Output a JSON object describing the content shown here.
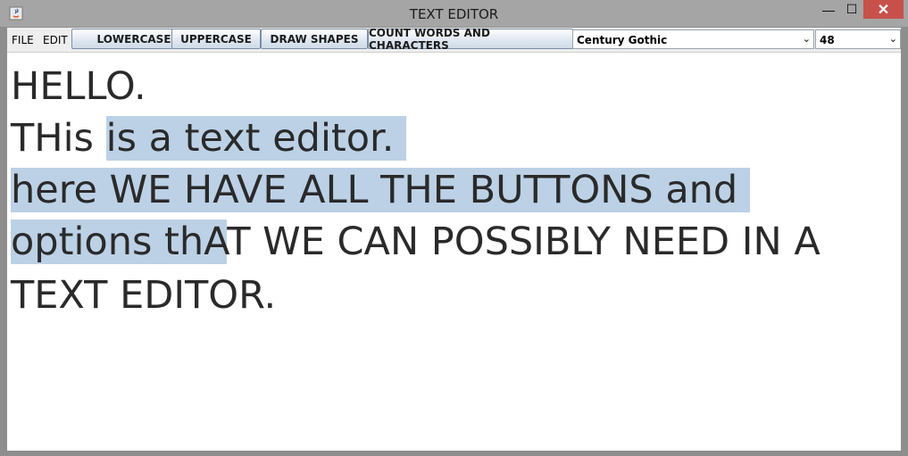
{
  "window": {
    "title": "TEXT EDITOR",
    "controls": {
      "minimize": "—",
      "maximize": "☐",
      "close": "✕"
    }
  },
  "menu": {
    "file": "FILE",
    "edit": "EDIT"
  },
  "toolbar": {
    "lowercase_label": "LOWERCASE",
    "uppercase_label": "UPPERCASE",
    "draw_shapes_label": "DRAW SHAPES",
    "count_label": "COUNT WORDS AND CHARACTERS",
    "font_value": "Century Gothic",
    "size_value": "48"
  },
  "editor": {
    "line1": {
      "text": "HELLO."
    },
    "line2": {
      "pre": "THis ",
      "selected": "is a text editor. "
    },
    "line3": {
      "selected": "here WE HAVE ALL THE BUTTONS and "
    },
    "line4": {
      "selected": "options thA",
      "post": "T WE CAN POSSIBLY NEED IN A"
    },
    "line5": {
      "text": "TEXT EDITOR."
    }
  },
  "colors": {
    "selection": "#bcd1e6",
    "close_button": "#c7504b",
    "title_bar": "#a5a5a5"
  }
}
